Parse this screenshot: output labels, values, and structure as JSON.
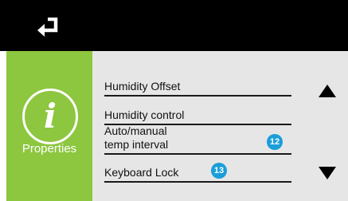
{
  "header": {
    "back_icon": "return-arrow-icon"
  },
  "sidebar": {
    "icon": "info-icon",
    "icon_glyph": "i",
    "label": "Properties",
    "color": "#8dc63f"
  },
  "list": {
    "items": [
      {
        "label": "Humidity Offset"
      },
      {
        "label": "Humidity control"
      },
      {
        "label_line1": "Auto/manual",
        "label_line2": "temp interval"
      },
      {
        "label": "Keyboard Lock"
      }
    ]
  },
  "callouts": {
    "badge_12": "12",
    "badge_13": "13",
    "color": "#1a9ed9"
  },
  "scroll": {
    "up_icon": "triangle-up-icon",
    "down_icon": "triangle-down-icon"
  }
}
